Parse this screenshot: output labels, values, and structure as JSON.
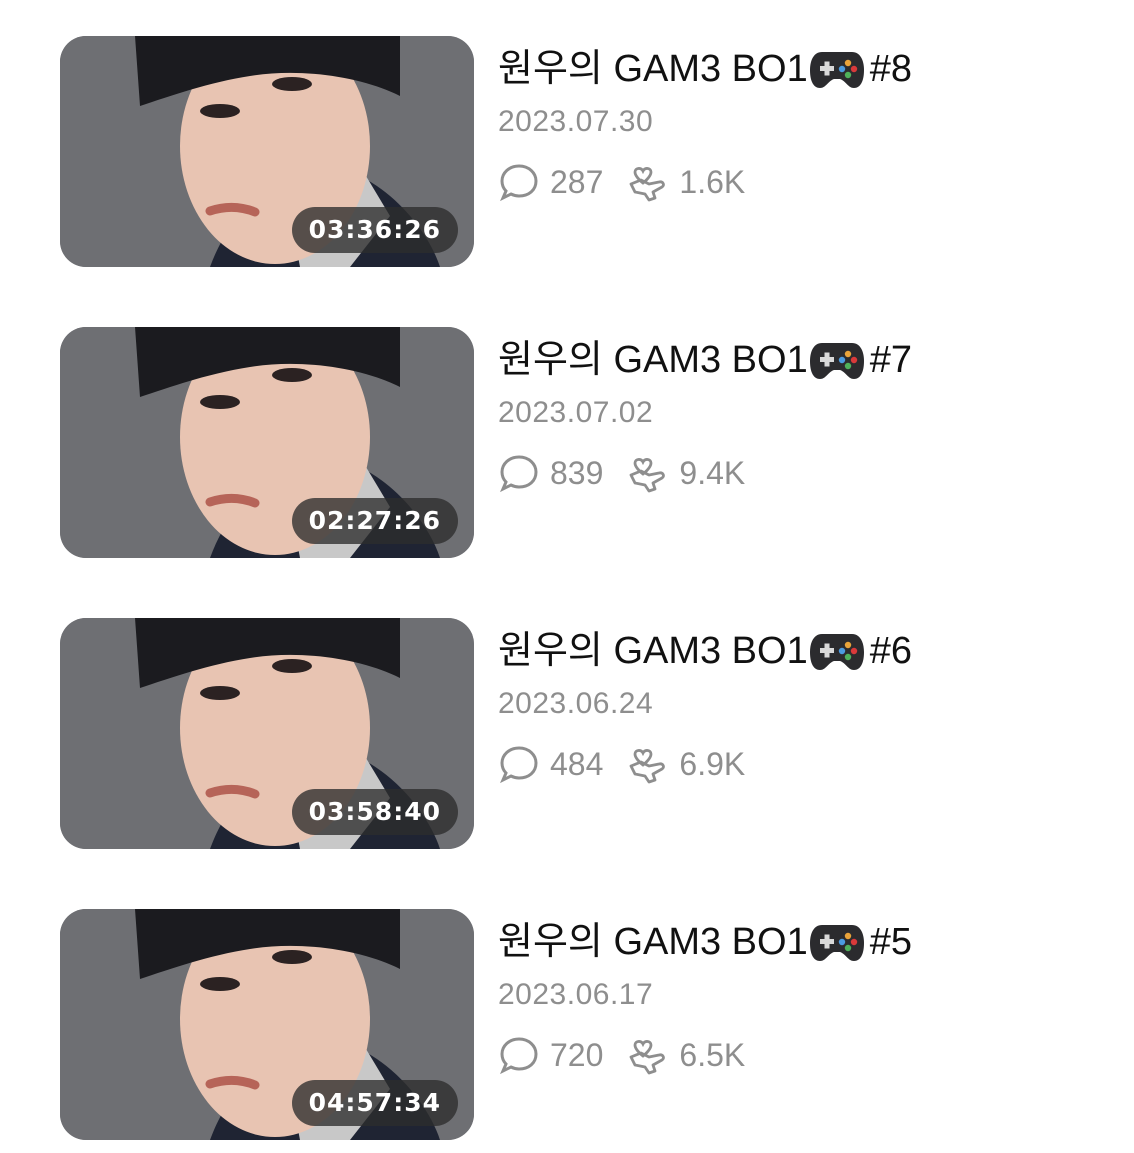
{
  "videos": [
    {
      "title_prefix": "원우의 GAM3 BO1",
      "title_suffix": "#8",
      "date": "2023.07.30",
      "comments": "287",
      "likes": "1.6K",
      "duration": "03:36:26"
    },
    {
      "title_prefix": "원우의 GAM3 BO1",
      "title_suffix": "#7",
      "date": "2023.07.02",
      "comments": "839",
      "likes": "9.4K",
      "duration": "02:27:26"
    },
    {
      "title_prefix": "원우의 GAM3 BO1",
      "title_suffix": "#6",
      "date": "2023.06.24",
      "comments": "484",
      "likes": "6.9K",
      "duration": "03:58:40"
    },
    {
      "title_prefix": "원우의 GAM3 BO1",
      "title_suffix": "#5",
      "date": "2023.06.17",
      "comments": "720",
      "likes": "6.5K",
      "duration": "04:57:34"
    }
  ],
  "icons": {
    "title_emoji": "game-controller-icon",
    "comments": "speech-bubble-icon",
    "likes": "heart-hand-icon"
  },
  "colors": {
    "title_text": "#111111",
    "meta_text": "#8e8e8e",
    "duration_badge_bg": "#2d2d2d",
    "duration_badge_text": "#ffffff"
  }
}
